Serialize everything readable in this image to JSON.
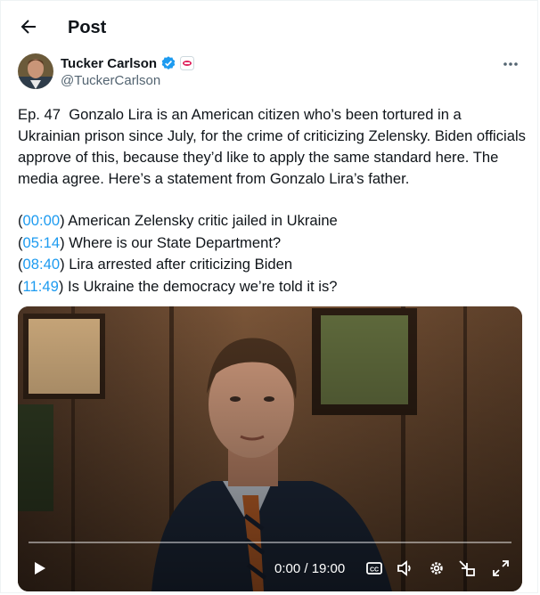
{
  "header": {
    "title": "Post"
  },
  "author": {
    "name": "Tucker Carlson",
    "handle": "@TuckerCarlson"
  },
  "tweet": {
    "body": "Ep. 47  Gonzalo Lira is an American citizen who’s been tortured in a Ukrainian prison since July, for the crime of criticizing Zelensky. Biden officials approve of this, because they’d like to apply the same standard here. The media agree. Here’s a statement from Gonzalo Lira’s father.",
    "chapters": [
      {
        "time": "00:00",
        "title": "American Zelensky critic jailed in Ukraine"
      },
      {
        "time": "05:14",
        "title": "Where is our State Department?"
      },
      {
        "time": "08:40",
        "title": "Lira arrested after criticizing Biden"
      },
      {
        "time": "11:49",
        "title": "Is Ukraine the democracy we’re told it is?"
      }
    ]
  },
  "video": {
    "time_display": "0:00 / 19:00",
    "progress": 0
  },
  "icons": {
    "back": "arrow-left-icon",
    "verified": "verified-badge-icon",
    "affiliate": "affiliate-badge-icon",
    "more": "more-dots-icon",
    "play": "play-icon",
    "cc": "captions-icon",
    "volume": "volume-icon",
    "settings": "gear-icon",
    "pip": "picture-in-picture-icon",
    "fullscreen": "fullscreen-icon"
  },
  "colors": {
    "accent": "#1d9bf0",
    "text": "#0f1419",
    "secondary": "#536471"
  }
}
